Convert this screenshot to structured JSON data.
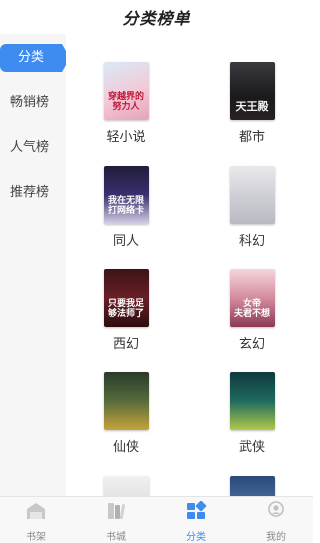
{
  "header": {
    "title": "分类榜单"
  },
  "sidebar": {
    "items": [
      {
        "label": "分类",
        "active": true
      },
      {
        "label": "畅销榜",
        "active": false
      },
      {
        "label": "人气榜",
        "active": false
      },
      {
        "label": "推荐榜",
        "active": false
      }
    ]
  },
  "categories": [
    {
      "name": "轻小说",
      "cover_text": "穿越界的\n努力人"
    },
    {
      "name": "都市",
      "cover_text": "天王殿"
    },
    {
      "name": "同人",
      "cover_text": "我在无限\n打网络卡"
    },
    {
      "name": "科幻",
      "cover_text": ""
    },
    {
      "name": "西幻",
      "cover_text": "只要我足\n够法师了"
    },
    {
      "name": "玄幻",
      "cover_text": "女帝\n夫君不想"
    },
    {
      "name": "仙侠",
      "cover_text": ""
    },
    {
      "name": "武侠",
      "cover_text": ""
    }
  ],
  "tabbar": {
    "items": [
      {
        "label": "书架",
        "icon": "bookshelf-icon"
      },
      {
        "label": "书城",
        "icon": "bookstore-icon"
      },
      {
        "label": "分类",
        "icon": "category-icon",
        "active": true
      },
      {
        "label": "我的",
        "icon": "profile-icon"
      }
    ]
  },
  "colors": {
    "accent": "#3f8cf1",
    "sidebar_bg": "#f6f6f6",
    "tabbar_bg": "#f8f8f8"
  }
}
